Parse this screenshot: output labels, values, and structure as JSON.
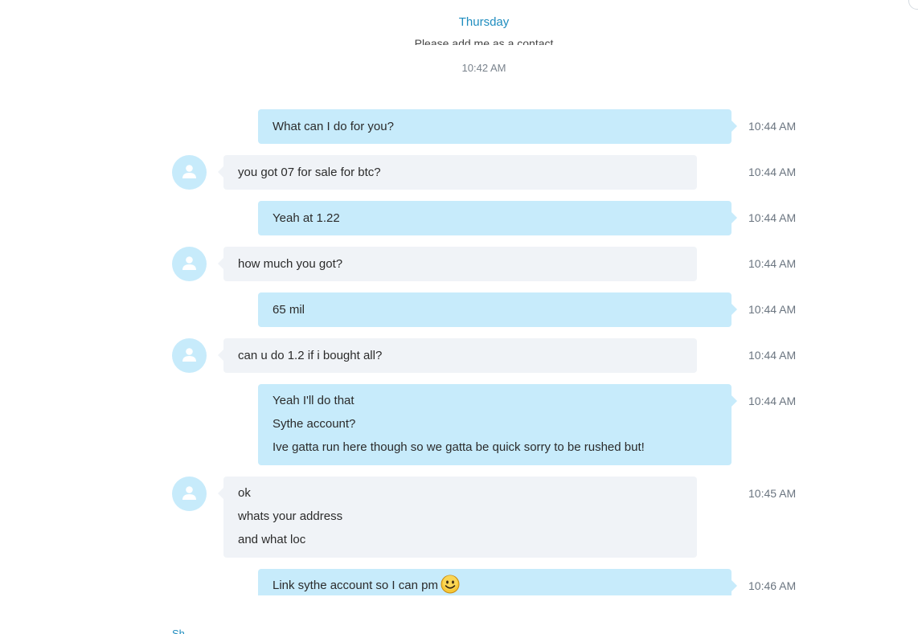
{
  "header": {
    "day": "Thursday",
    "system_message": "Please add me as a contact",
    "system_time": "10:42 AM"
  },
  "messages": [
    {
      "direction": "out",
      "lines": [
        "What can I do for you?"
      ],
      "time": "10:44 AM"
    },
    {
      "direction": "in",
      "lines": [
        "you got 07 for sale for btc?"
      ],
      "time": "10:44 AM"
    },
    {
      "direction": "out",
      "lines": [
        "Yeah at 1.22"
      ],
      "time": "10:44 AM"
    },
    {
      "direction": "in",
      "lines": [
        "how much you got?"
      ],
      "time": "10:44 AM"
    },
    {
      "direction": "out",
      "lines": [
        "65 mil"
      ],
      "time": "10:44 AM"
    },
    {
      "direction": "in",
      "lines": [
        "can u do 1.2 if i bought all?"
      ],
      "time": "10:44 AM"
    },
    {
      "direction": "out",
      "lines": [
        "Yeah I'll do that",
        "Sythe account?",
        "Ive gatta run here though so we gatta be quick sorry to be rushed but!"
      ],
      "time": "10:44 AM"
    },
    {
      "direction": "in",
      "lines": [
        "ok",
        "whats your address",
        "and what loc"
      ],
      "time": "10:45 AM"
    },
    {
      "direction": "out",
      "lines": [
        "Link sythe account so I can pm"
      ],
      "time": "10:46 AM",
      "emoji": "smile-emoji"
    }
  ],
  "footer": {
    "hint": "Sh"
  },
  "colors": {
    "outgoing_bubble": "#c7ebfb",
    "incoming_bubble": "#f0f3f7",
    "accent": "#1f8dbf",
    "timestamp": "#6b7580"
  }
}
